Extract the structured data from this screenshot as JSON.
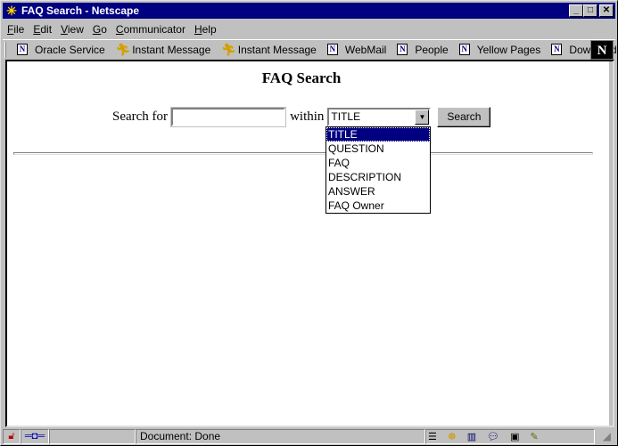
{
  "window": {
    "title": "FAQ Search - Netscape",
    "app_icon": "netscape-star-icon",
    "controls": [
      "minimize",
      "maximize",
      "close"
    ]
  },
  "menu": [
    {
      "label": "File",
      "accel": "F"
    },
    {
      "label": "Edit",
      "accel": "E"
    },
    {
      "label": "View",
      "accel": "V"
    },
    {
      "label": "Go",
      "accel": "G"
    },
    {
      "label": "Communicator",
      "accel": "C"
    },
    {
      "label": "Help",
      "accel": "H"
    }
  ],
  "toolbar": {
    "items": [
      {
        "label": "Oracle Service",
        "icon": "bookmark-page-icon"
      },
      {
        "label": "Instant Message",
        "icon": "aim-running-man-icon"
      },
      {
        "label": "Instant Message",
        "icon": "aim-running-man-icon"
      },
      {
        "label": "WebMail",
        "icon": "bookmark-page-icon"
      },
      {
        "label": "People",
        "icon": "bookmark-page-icon"
      },
      {
        "label": "Yellow Pages",
        "icon": "bookmark-page-icon"
      },
      {
        "label": "Download",
        "icon": "bookmark-page-icon"
      }
    ],
    "logo": "N"
  },
  "page": {
    "heading": "FAQ Search",
    "search_for_label": "Search for",
    "search_value": "",
    "within_label": "within",
    "within_selected": "TITLE",
    "within_options": [
      "TITLE",
      "QUESTION",
      "FAQ",
      "DESCRIPTION",
      "ANSWER",
      "FAQ Owner"
    ],
    "search_button": "Search"
  },
  "status": {
    "text": "Document: Done"
  }
}
